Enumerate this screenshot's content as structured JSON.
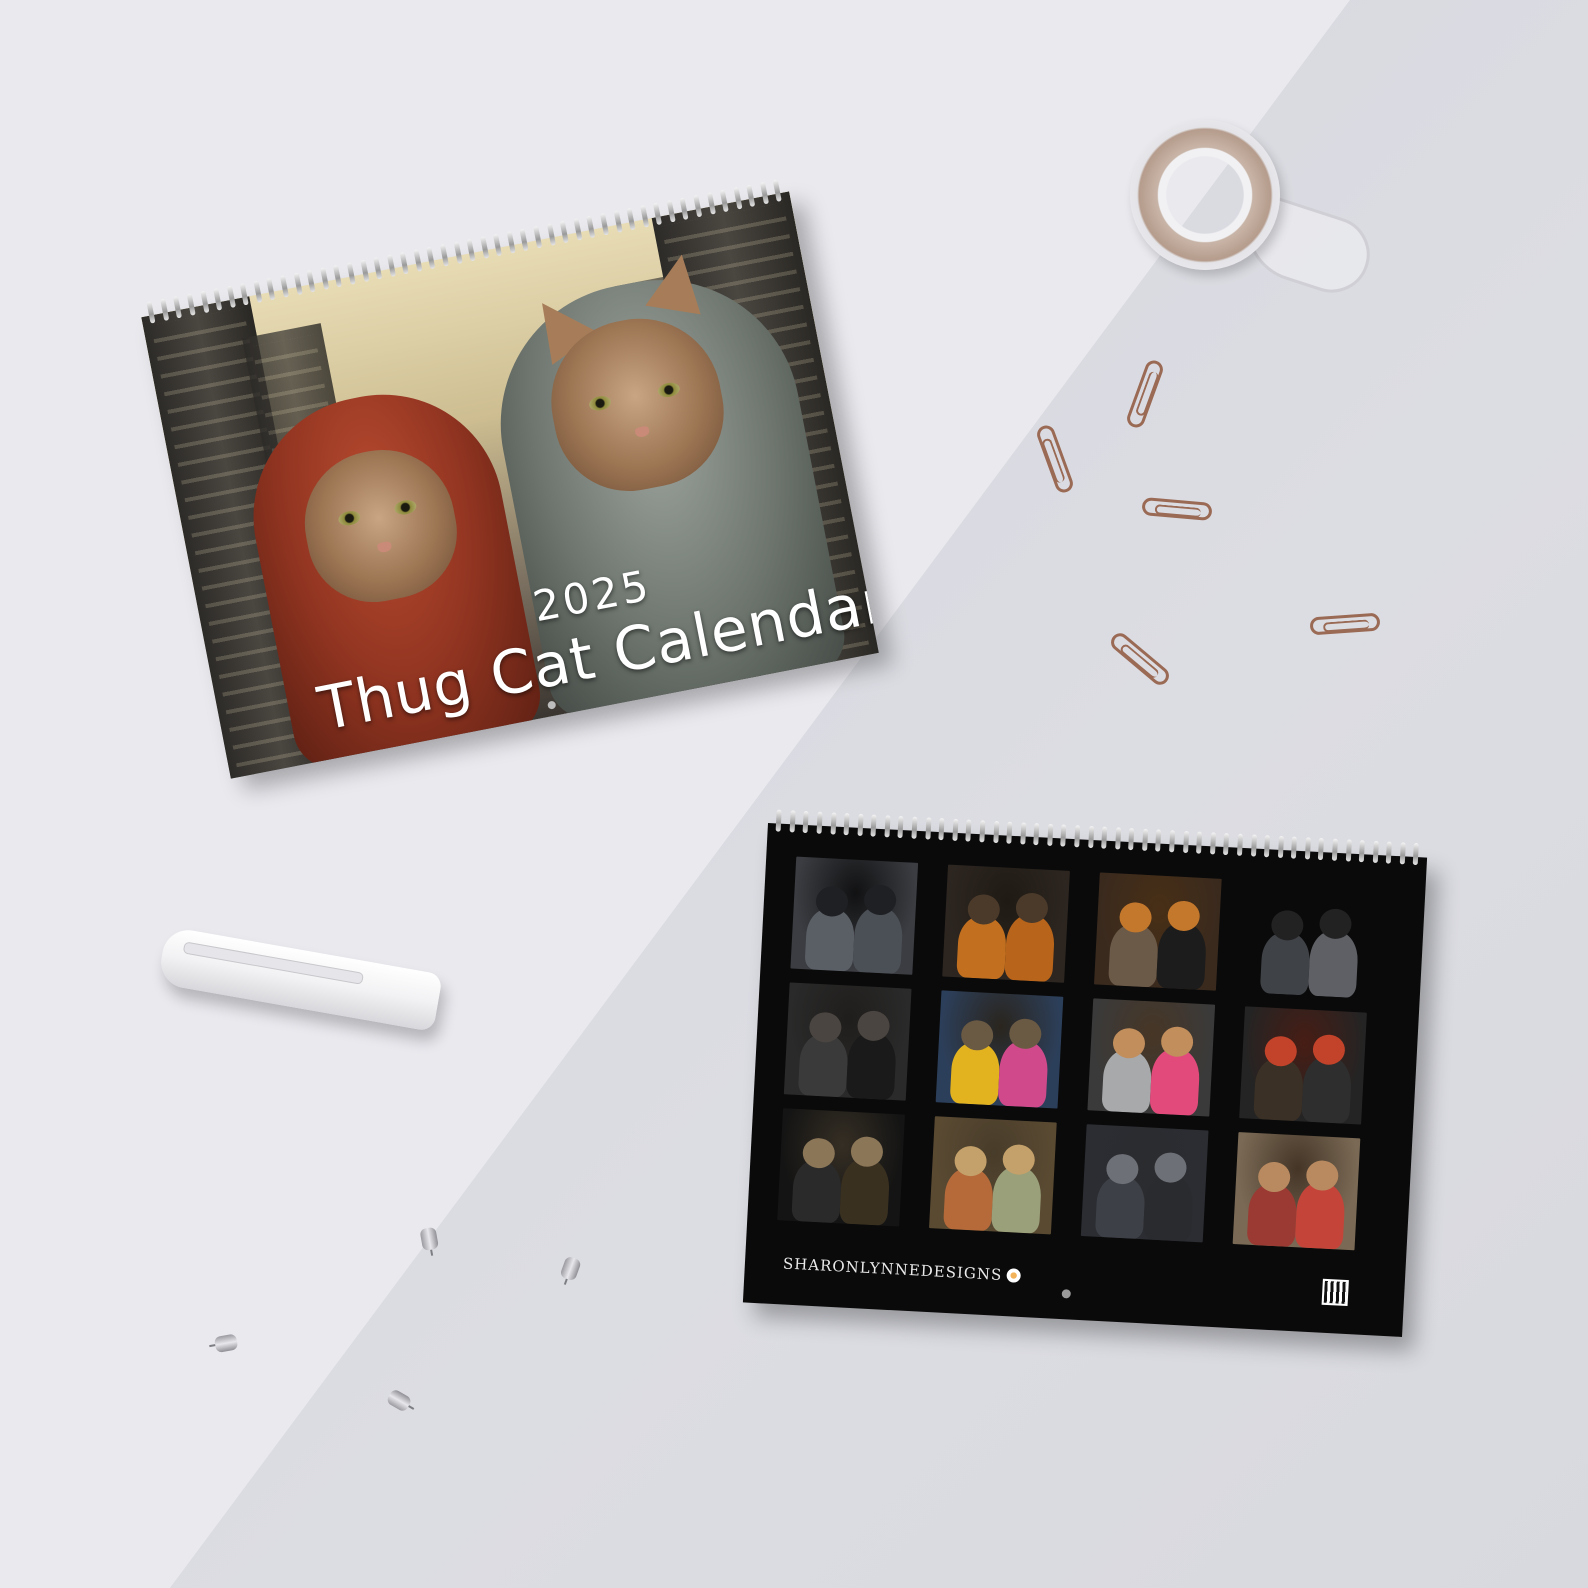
{
  "front_calendar": {
    "year": "2025",
    "title": "Thug Cat Calendar"
  },
  "back_calendar": {
    "brand": "SHARONLYNNEDESIGNS",
    "thumbnails": [
      {
        "bg": "#3b3d42",
        "c1": "#5a5f66",
        "c2": "#4b4f56",
        "h": "#1f2023"
      },
      {
        "bg": "#2d2620",
        "c1": "#c2701f",
        "c2": "#b8641a",
        "h": "#4b3a2a"
      },
      {
        "bg": "#3a2a1e",
        "c1": "#6b5a48",
        "c2": "#1c1c1c",
        "h": "#c4782c"
      },
      {
        "bg": "#2f3136",
        "c1": "#3f4247",
        "c2": "#5e6066",
        "h": "#222"
      },
      {
        "bg": "#2a2a2a",
        "c1": "#3a3a3a",
        "c2": "#1a1a1a",
        "h": "#4a4540"
      },
      {
        "bg": "#2c3f5a",
        "c1": "#e3b21f",
        "c2": "#d04a8b",
        "h": "#6a5a44"
      },
      {
        "bg": "#3a3a3a",
        "c1": "#a7a9ab",
        "c2": "#e24a7c",
        "h": "#c18e5c"
      },
      {
        "bg": "#242424",
        "c1": "#3b3025",
        "c2": "#2e2e2e",
        "h": "#c2432a"
      },
      {
        "bg": "#141414",
        "c1": "#2a2a2a",
        "c2": "#3a3020",
        "h": "#8b7657"
      },
      {
        "bg": "#5a4a32",
        "c1": "#b66a3a",
        "c2": "#9aa07a",
        "h": "#c4a16a"
      },
      {
        "bg": "#2b2d33",
        "c1": "#3e4048",
        "c2": "#2a2b2f",
        "h": "#6e7078"
      },
      {
        "bg": "#7a6a55",
        "c1": "#9a3a32",
        "c2": "#c4443a",
        "h": "#b98a60"
      }
    ]
  },
  "colors": {
    "background_light": "#e9e9ee",
    "background_dark": "#d3d4dc",
    "paperclip": "#9a6a55"
  }
}
